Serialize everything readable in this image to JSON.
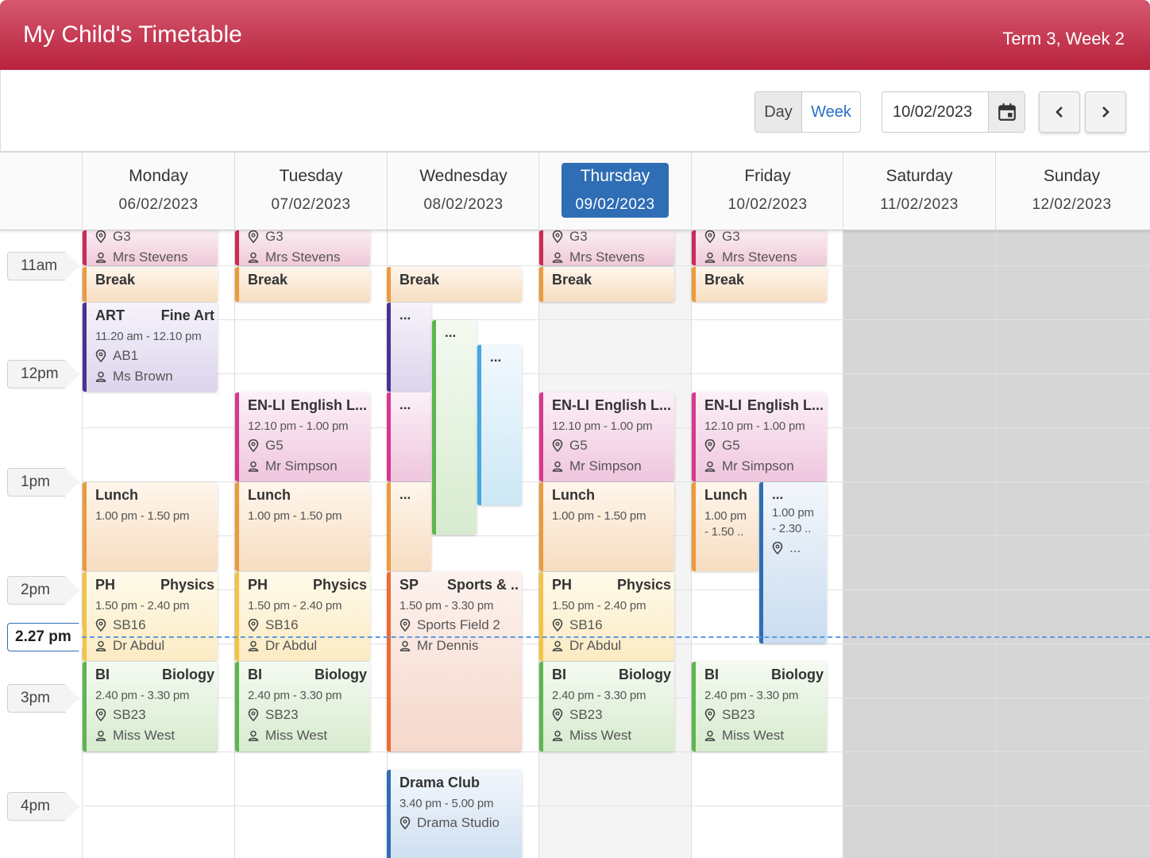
{
  "header": {
    "title": "My Child's Timetable",
    "term": "Term 3, Week 2"
  },
  "toolbar": {
    "day_label": "Day",
    "week_label": "Week",
    "date_value": "10/02/2023"
  },
  "days": [
    {
      "name": "Monday",
      "date": "06/02/2023"
    },
    {
      "name": "Tuesday",
      "date": "07/02/2023"
    },
    {
      "name": "Wednesday",
      "date": "08/02/2023"
    },
    {
      "name": "Thursday",
      "date": "09/02/2023"
    },
    {
      "name": "Friday",
      "date": "10/02/2023"
    },
    {
      "name": "Saturday",
      "date": "11/02/2023"
    },
    {
      "name": "Sunday",
      "date": "12/02/2023"
    }
  ],
  "times": [
    "11am",
    "12pm",
    "1pm",
    "2pm",
    "3pm",
    "4pm"
  ],
  "current_time": "2.27 pm",
  "ellipsis": "...",
  "events": {
    "english_top": {
      "room": "G3",
      "teacher": "Mrs Stevens"
    },
    "break": {
      "name": "Break"
    },
    "art": {
      "code": "ART",
      "name": "Fine Art",
      "time": "11.20 am - 12.10 pm",
      "room": "AB1",
      "teacher": "Ms Brown"
    },
    "enli": {
      "code": "EN-LI",
      "name": "English L...",
      "time": "12.10 pm - 1.00 pm",
      "room": "G5",
      "teacher": "Mr Simpson"
    },
    "lunch": {
      "name": "Lunch",
      "time": "1.00 pm - 1.50 pm",
      "time_a": "1.00 pm",
      "time_b": "- 1.50 .."
    },
    "friday_extra": {
      "time_a": "1.00 pm",
      "time_b": "- 2.30 ..",
      "room": "..."
    },
    "ph": {
      "code": "PH",
      "name": "Physics",
      "time": "1.50 pm - 2.40 pm",
      "room": "SB16",
      "teacher": "Dr Abdul"
    },
    "bi": {
      "code": "BI",
      "name": "Biology",
      "time": "2.40 pm - 3.30 pm",
      "room": "SB23",
      "teacher": "Miss West"
    },
    "sp": {
      "code": "SP",
      "name": "Sports & ..",
      "time": "1.50 pm - 3.30 pm",
      "room": "Sports Field 2",
      "teacher": "Mr Dennis"
    },
    "drama": {
      "name": "Drama Club",
      "time": "3.40 pm - 5.00 pm",
      "room": "Drama Studio"
    }
  }
}
